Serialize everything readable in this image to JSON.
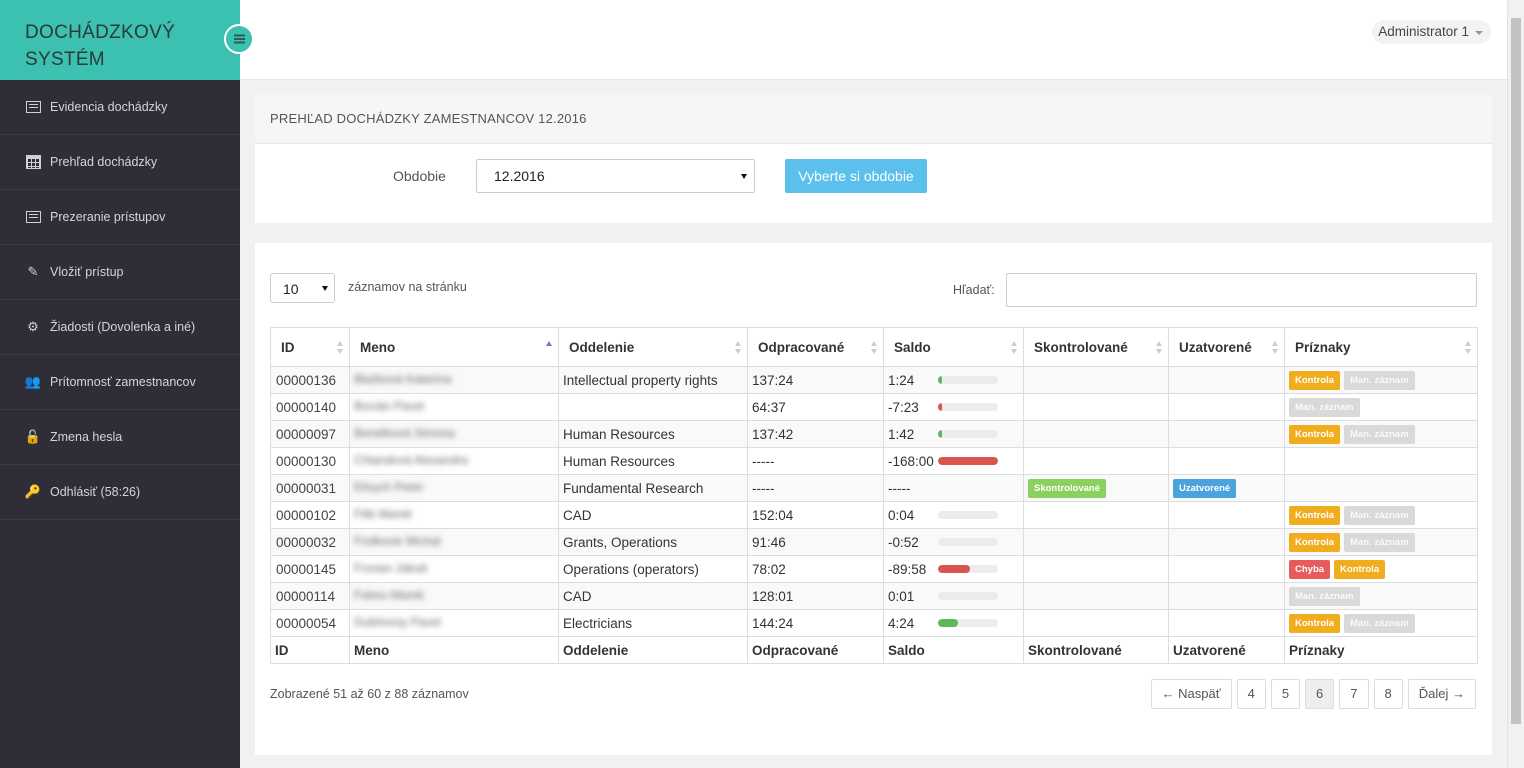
{
  "app": {
    "brand_line1": "DOCHÁDZKOVÝ",
    "brand_line2": "SYSTÉM"
  },
  "user": {
    "name": "Administrator 1"
  },
  "sidebar": {
    "items": [
      {
        "label": "Evidencia dochádzky",
        "icon": "list-icon"
      },
      {
        "label": "Prehľad dochádzky",
        "icon": "calendar-icon"
      },
      {
        "label": "Prezeranie prístupov",
        "icon": "list-icon"
      },
      {
        "label": "Vložiť prístup",
        "icon": "edit-icon"
      },
      {
        "label": "Žiadosti (Dovolenka a iné)",
        "icon": "gear-icon"
      },
      {
        "label": "Prítomnosť zamestnancov",
        "icon": "users-icon"
      },
      {
        "label": "Zmena hesla",
        "icon": "unlock-icon"
      },
      {
        "label": "Odhlásiť (58:26)",
        "icon": "key-icon"
      }
    ]
  },
  "filter": {
    "title": "PREHĽAD DOCHÁDZKY ZAMESTNANCOV 12.2016",
    "period_label": "Obdobie",
    "period_value": "12.2016",
    "button": "Vyberte si obdobie"
  },
  "table_controls": {
    "page_length": "10",
    "page_length_label": "záznamov na stránku",
    "search_label": "Hľadať:",
    "search_value": ""
  },
  "table": {
    "columns": [
      "ID",
      "Meno",
      "Oddelenie",
      "Odpracované",
      "Saldo",
      "Skontrolované",
      "Uzatvorené",
      "Príznaky"
    ],
    "sorted_column": "Meno",
    "rows": [
      {
        "id": "00000136",
        "name": "Blažková Katarína",
        "dept": "Intellectual property rights",
        "worked": "137:24",
        "saldo": "1:24",
        "bar": {
          "kind": "pos",
          "fraction": 0.05
        },
        "checked": "",
        "closed": "",
        "flags": [
          "Kontrola",
          "Man. záznam"
        ]
      },
      {
        "id": "00000140",
        "name": "Bocián Pavel",
        "dept": "",
        "worked": "64:37",
        "saldo": "-7:23",
        "bar": {
          "kind": "neg",
          "fraction": 0.03
        },
        "checked": "",
        "closed": "",
        "flags": [
          "Man. záznam"
        ]
      },
      {
        "id": "00000097",
        "name": "Bendíková Simona",
        "dept": "Human Resources",
        "worked": "137:42",
        "saldo": "1:42",
        "bar": {
          "kind": "pos",
          "fraction": 0.06
        },
        "checked": "",
        "closed": "",
        "flags": [
          "Kontrola",
          "Man. záznam"
        ]
      },
      {
        "id": "00000130",
        "name": "Chlandová Alexandra",
        "dept": "Human Resources",
        "worked": "-----",
        "saldo": "-168:00",
        "bar": {
          "kind": "neg",
          "fraction": 1.0
        },
        "checked": "",
        "closed": "",
        "flags": []
      },
      {
        "id": "00000031",
        "name": "Ehrych Peter",
        "dept": "Fundamental Research",
        "worked": "-----",
        "saldo": "-----",
        "bar": null,
        "checked": "Skontrolované",
        "closed": "Uzatvorené",
        "flags": []
      },
      {
        "id": "00000102",
        "name": "Filik Marek",
        "dept": "CAD",
        "worked": "152:04",
        "saldo": "0:04",
        "bar": {
          "kind": "pos",
          "fraction": 0.0
        },
        "checked": "",
        "closed": "",
        "flags": [
          "Kontrola",
          "Man. záznam"
        ]
      },
      {
        "id": "00000032",
        "name": "Frolkovie Michal",
        "dept": "Grants, Operations",
        "worked": "91:46",
        "saldo": "-0:52",
        "bar": {
          "kind": "neg",
          "fraction": 0.0
        },
        "checked": "",
        "closed": "",
        "flags": [
          "Kontrola",
          "Man. záznam"
        ]
      },
      {
        "id": "00000145",
        "name": "Fronan Jakub",
        "dept": "Operations (operators)",
        "worked": "78:02",
        "saldo": "-89:58",
        "bar": {
          "kind": "neg",
          "fraction": 0.53
        },
        "checked": "",
        "closed": "",
        "flags": [
          "Chyba",
          "Kontrola"
        ]
      },
      {
        "id": "00000114",
        "name": "Fekeu Marek",
        "dept": "CAD",
        "worked": "128:01",
        "saldo": "0:01",
        "bar": {
          "kind": "pos",
          "fraction": 0.0
        },
        "checked": "",
        "closed": "",
        "flags": [
          "Man. záznam"
        ]
      },
      {
        "id": "00000054",
        "name": "Dubňovsy Pavel",
        "dept": "Electricians",
        "worked": "144:24",
        "saldo": "4:24",
        "bar": {
          "kind": "pos",
          "fraction": 0.33
        },
        "checked": "",
        "closed": "",
        "flags": [
          "Kontrola",
          "Man. záznam"
        ]
      }
    ]
  },
  "info": "Zobrazené 51 až 60 z 88 záznamov",
  "pager": {
    "prev": "← Naspäť",
    "pages": [
      "4",
      "5",
      "6",
      "7",
      "8"
    ],
    "current": "6",
    "next": "Ďalej →"
  },
  "colors": {
    "brand": "#3cc0b0",
    "sidebar": "#2f2e38",
    "kontrola": "#f0ad1e",
    "chyba": "#e65c5c",
    "skontrolovane": "#8bd160",
    "uzatvorene": "#4aa3df",
    "button": "#5bc0eb"
  }
}
